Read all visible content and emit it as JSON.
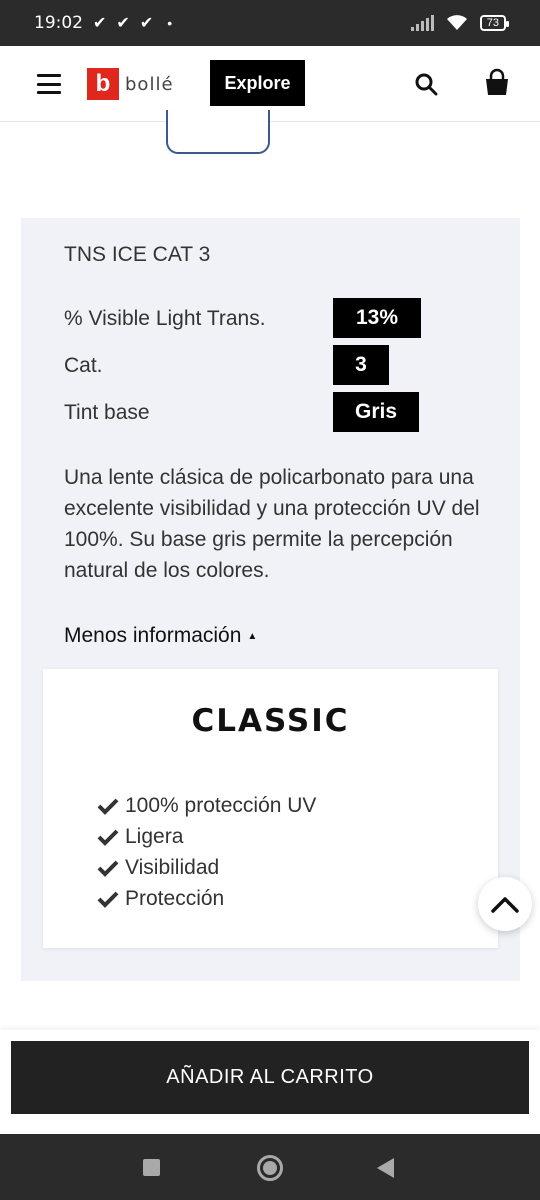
{
  "status_bar": {
    "time": "19:02",
    "checks": [
      "✔",
      "✔",
      "✔"
    ],
    "dot": "•",
    "battery": "73"
  },
  "header": {
    "logo_letter": "b",
    "logo_text": "bollé",
    "explore_label": "Explore",
    "icons": [
      "menu-icon",
      "search-icon",
      "shopping-bag-icon"
    ]
  },
  "lens": {
    "name": "TNS ICE CAT 3",
    "specs": [
      {
        "label": "% Visible Light Trans.",
        "value": "13%"
      },
      {
        "label": "Cat.",
        "value": "3"
      },
      {
        "label": "Tint base",
        "value": "Gris"
      }
    ],
    "description": "Una lente clásica de policarbonato para una excelente visibilidad y una protección UV del 100%. Su base gris permite la percepción natural de los colores.",
    "less_info_label": "Menos información",
    "less_info_arrow": "▲"
  },
  "classic": {
    "title": "CLASSIC",
    "features": [
      "100% protección UV",
      "Ligera",
      "Visibilidad",
      "Protección"
    ]
  },
  "cart": {
    "add_label": "AÑADIR AL CARRITO"
  },
  "colors": {
    "accent": "#000000",
    "panel_bg": "#f0f2f7",
    "logo_red": "#e0271e",
    "cart_button": "#222222"
  }
}
